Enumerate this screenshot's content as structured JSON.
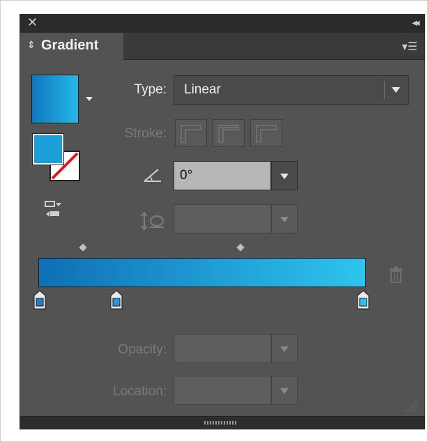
{
  "panel": {
    "close_icon_glyph": "✕",
    "collapse_icon_glyph": "◂◂",
    "tab_label": "Gradient",
    "tab_arrows_glyph": "⇕",
    "menu_icon_glyph": "▾☰"
  },
  "controls": {
    "type_label": "Type:",
    "type_value": "Linear",
    "stroke_label": "Stroke:",
    "angle_value": "0°",
    "opacity_label": "Opacity:",
    "location_label": "Location:"
  },
  "gradient": {
    "start_color": "#0f6fb6",
    "end_color": "#2ec4ef",
    "stop_colors": [
      "#1f7fc7",
      "#2698d6",
      "#2fc2ee"
    ]
  },
  "colors": {
    "panel_bg": "#535353",
    "titlebar_bg": "#2b2b2b",
    "fill_swatch": "#1a9fd9",
    "none_slash": "#e01818"
  }
}
